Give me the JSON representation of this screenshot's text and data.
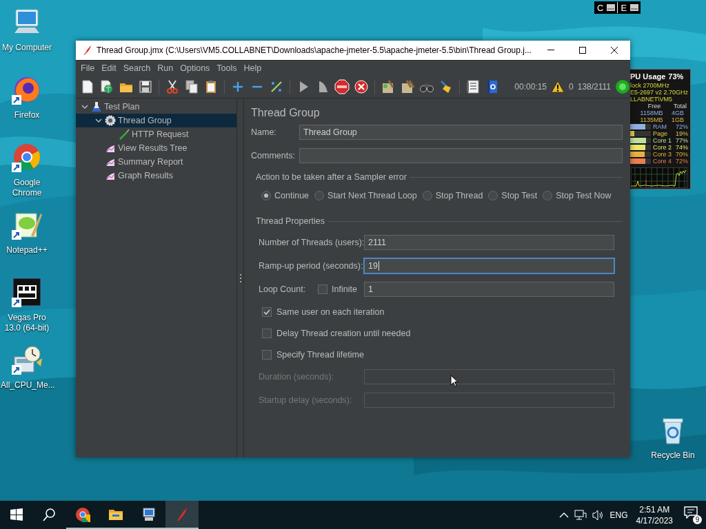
{
  "desktop": {
    "icons": [
      {
        "kind": "computer",
        "label": "My Computer",
        "shortcut": false
      },
      {
        "kind": "firefox",
        "label": "Firefox",
        "shortcut": true
      },
      {
        "kind": "chrome",
        "label": "Google Chrome",
        "shortcut": true
      },
      {
        "kind": "notepad",
        "label": "Notepad++",
        "shortcut": true
      },
      {
        "kind": "vegas",
        "label": "Vegas Pro 13.0 (64-bit)",
        "shortcut": true
      },
      {
        "kind": "cpu",
        "label": "All_CPU_Me...",
        "shortcut": true
      }
    ],
    "recycle_bin": {
      "label": "Recycle Bin"
    }
  },
  "drive_indicator": {
    "drives": [
      {
        "label": "C"
      },
      {
        "label": "E"
      }
    ]
  },
  "cpu_gadget": {
    "title": "PU Usage",
    "usage": "73%",
    "info": [
      "lock 2700MHz",
      "E5-2697 v2 2.70GHz",
      "LLABNET\\VM5"
    ],
    "columns": [
      "Free",
      "Total"
    ],
    "memory": [
      {
        "free": "1158MB",
        "total": "4GB",
        "color": "#8fb0e0"
      },
      {
        "free": "1135MB",
        "total": "1GB",
        "color": "#e0b848"
      }
    ],
    "meters": [
      {
        "name": "RAM",
        "value": "72%",
        "level": 0.72,
        "color": "#8fb0e0"
      },
      {
        "name": "Page",
        "value": "19%",
        "level": 0.19,
        "color": "#e0c848"
      },
      {
        "name": "Core 1",
        "value": "77%",
        "level": 0.77,
        "color": "#c0e0a0"
      },
      {
        "name": "Core 2",
        "value": "74%",
        "level": 0.74,
        "color": "#e8e870"
      },
      {
        "name": "Core 3",
        "value": "70%",
        "level": 0.7,
        "color": "#e8b040"
      },
      {
        "name": "Core 4",
        "value": "72%",
        "level": 0.72,
        "color": "#e88050"
      }
    ]
  },
  "window": {
    "title": "Thread Group.jmx (C:\\Users\\VM5.COLLABNET\\Downloads\\apache-jmeter-5.5\\apache-jmeter-5.5\\bin\\Thread Group.j...",
    "menu": [
      "File",
      "Edit",
      "Search",
      "Run",
      "Options",
      "Tools",
      "Help"
    ],
    "status": {
      "elapsed": "00:00:15",
      "warnings": "0",
      "threads": "138/2111",
      "running": true
    },
    "tree": [
      {
        "label": "Test Plan",
        "kind": "plan",
        "expanded": true,
        "selected": false,
        "children": [
          {
            "label": "Thread Group",
            "kind": "thread-group",
            "expanded": true,
            "selected": true,
            "children": [
              {
                "label": "HTTP Request",
                "kind": "sampler",
                "selected": false
              }
            ]
          },
          {
            "label": "View Results Tree",
            "kind": "listener",
            "selected": false
          },
          {
            "label": "Summary Report",
            "kind": "listener",
            "selected": false
          },
          {
            "label": "Graph Results",
            "kind": "listener",
            "selected": false
          }
        ]
      }
    ],
    "form": {
      "heading": "Thread Group",
      "name": {
        "label": "Name:",
        "value": "Thread Group"
      },
      "comments": {
        "label": "Comments:"
      },
      "error_action": {
        "legend": "Action to be taken after a Sampler error",
        "options": [
          {
            "label": "Continue",
            "selected": true
          },
          {
            "label": "Start Next Thread Loop",
            "selected": false
          },
          {
            "label": "Stop Thread",
            "selected": false
          },
          {
            "label": "Stop Test",
            "selected": false
          },
          {
            "label": "Stop Test Now",
            "selected": false
          }
        ]
      },
      "thread_properties": {
        "legend": "Thread Properties",
        "fields": [
          {
            "label": "Number of Threads (users):",
            "value": "2111",
            "focused": false
          },
          {
            "label": "Ramp-up period (seconds):",
            "value": "19",
            "focused": true
          }
        ],
        "loop": {
          "label": "Loop Count:",
          "infinite_label": "Infinite",
          "infinite": false,
          "value": "1"
        },
        "options": [
          {
            "label": "Same user on each iteration",
            "checked": true
          },
          {
            "label": "Delay Thread creation until needed",
            "checked": false
          },
          {
            "label": "Specify Thread lifetime",
            "checked": false
          }
        ],
        "lifetime": [
          {
            "label": "Duration (seconds):",
            "disabled": true
          },
          {
            "label": "Startup delay (seconds):",
            "disabled": true
          }
        ]
      }
    }
  },
  "taskbar": {
    "apps": [
      {
        "kind": "start",
        "running": false,
        "selected": false
      },
      {
        "kind": "search",
        "running": false,
        "selected": false
      },
      {
        "kind": "chrome",
        "running": true,
        "selected": false
      },
      {
        "kind": "explorer",
        "running": true,
        "selected": false
      },
      {
        "kind": "computer",
        "running": true,
        "selected": false
      },
      {
        "kind": "jmeter",
        "running": true,
        "selected": true
      }
    ],
    "language": "ENG",
    "time": "2:51 AM",
    "date": "4/17/2023",
    "notifications": "9"
  }
}
